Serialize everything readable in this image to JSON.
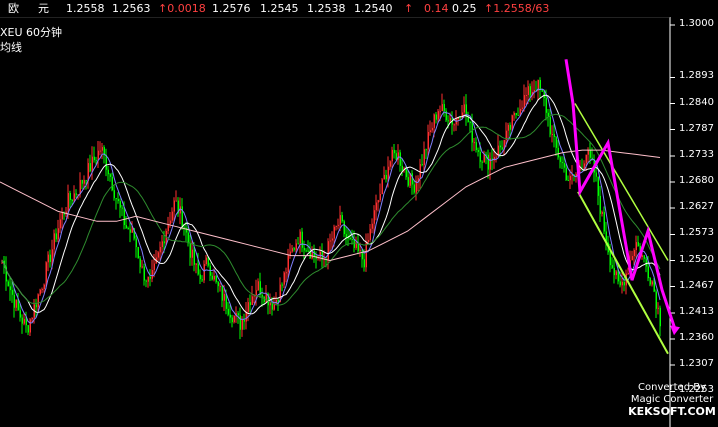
{
  "topbar": {
    "items": [
      {
        "text": "欧",
        "color": "white"
      },
      {
        "text": "元",
        "color": "white"
      },
      {
        "text": "1.2558",
        "color": "white"
      },
      {
        "text": "1.2563",
        "color": "white"
      },
      {
        "text": "↑0.0018",
        "color": "red"
      },
      {
        "text": "1.2576",
        "color": "white"
      },
      {
        "text": "1.2545",
        "color": "white"
      },
      {
        "text": "1.2538",
        "color": "white"
      },
      {
        "text": "1.2540",
        "color": "white"
      },
      {
        "text": "↑",
        "color": "red"
      },
      {
        "text": "0.14",
        "color": "red"
      },
      {
        "text": "0.25",
        "color": "white"
      },
      {
        "text": "↑1.2558/63",
        "color": "red"
      }
    ]
  },
  "chart_header": {
    "symbol": "XEU   60分钟",
    "ma_label": "均线"
  },
  "y_axis": {
    "ticks": [
      "1.3000",
      "1.2893",
      "1.2840",
      "1.2787",
      "1.2733",
      "1.2680",
      "1.2627",
      "1.2573",
      "1.2520",
      "1.2467",
      "1.2413",
      "1.2360",
      "1.2307",
      "1.2253"
    ],
    "tick_values": [
      1.3,
      1.2893,
      1.284,
      1.2787,
      1.2733,
      1.268,
      1.2627,
      1.2573,
      1.252,
      1.2467,
      1.2413,
      1.236,
      1.2307,
      1.2253
    ]
  },
  "watermark": {
    "line1": "Converted By",
    "line2": "Magic Converter",
    "line3": "KEKSOFT.COM"
  },
  "colors": {
    "background": "#000000",
    "axis": "#ffffff",
    "up_candle": "#ff3030",
    "down_candle": "#00ff00",
    "ma_fast": "#8080ff",
    "ma_mid": "#ffffff",
    "ma_slow": "#ffc0cb",
    "ma_slowest": "#2e8b2e",
    "trend_line": "#b0ff40",
    "forecast_line": "#ff00ff"
  },
  "chart_data": {
    "type": "candlestick",
    "title": "XEU 60分钟",
    "ylim": [
      1.2253,
      1.3
    ],
    "close_path": [
      1.252,
      1.246,
      1.2413,
      1.238,
      1.243,
      1.248,
      1.254,
      1.26,
      1.264,
      1.266,
      1.269,
      1.272,
      1.275,
      1.27,
      1.264,
      1.259,
      1.257,
      1.25,
      1.247,
      1.253,
      1.259,
      1.264,
      1.26,
      1.253,
      1.248,
      1.252,
      1.247,
      1.244,
      1.241,
      1.239,
      1.244,
      1.247,
      1.245,
      1.243,
      1.247,
      1.253,
      1.257,
      1.255,
      1.253,
      1.252,
      1.256,
      1.26,
      1.256,
      1.254,
      1.252,
      1.26,
      1.266,
      1.272,
      1.274,
      1.27,
      1.267,
      1.272,
      1.278,
      1.283,
      1.282,
      1.28,
      1.284,
      1.278,
      1.274,
      1.272,
      1.274,
      1.276,
      1.28,
      1.284,
      1.286,
      1.288,
      1.284,
      1.276,
      1.272,
      1.268,
      1.27,
      1.274,
      1.27,
      1.26,
      1.252,
      1.246,
      1.25,
      1.256,
      1.252,
      1.248,
      1.24
    ],
    "ma_slow": [
      1.268,
      1.266,
      1.264,
      1.262,
      1.261,
      1.26,
      1.26,
      1.261,
      1.26,
      1.259,
      1.258,
      1.257,
      1.256,
      1.255,
      1.254,
      1.253,
      1.253,
      1.252,
      1.253,
      1.254,
      1.256,
      1.258,
      1.261,
      1.264,
      1.267,
      1.269,
      1.271,
      1.272,
      1.273,
      1.274,
      1.2745,
      1.2745,
      1.274,
      1.2735,
      1.273
    ]
  }
}
